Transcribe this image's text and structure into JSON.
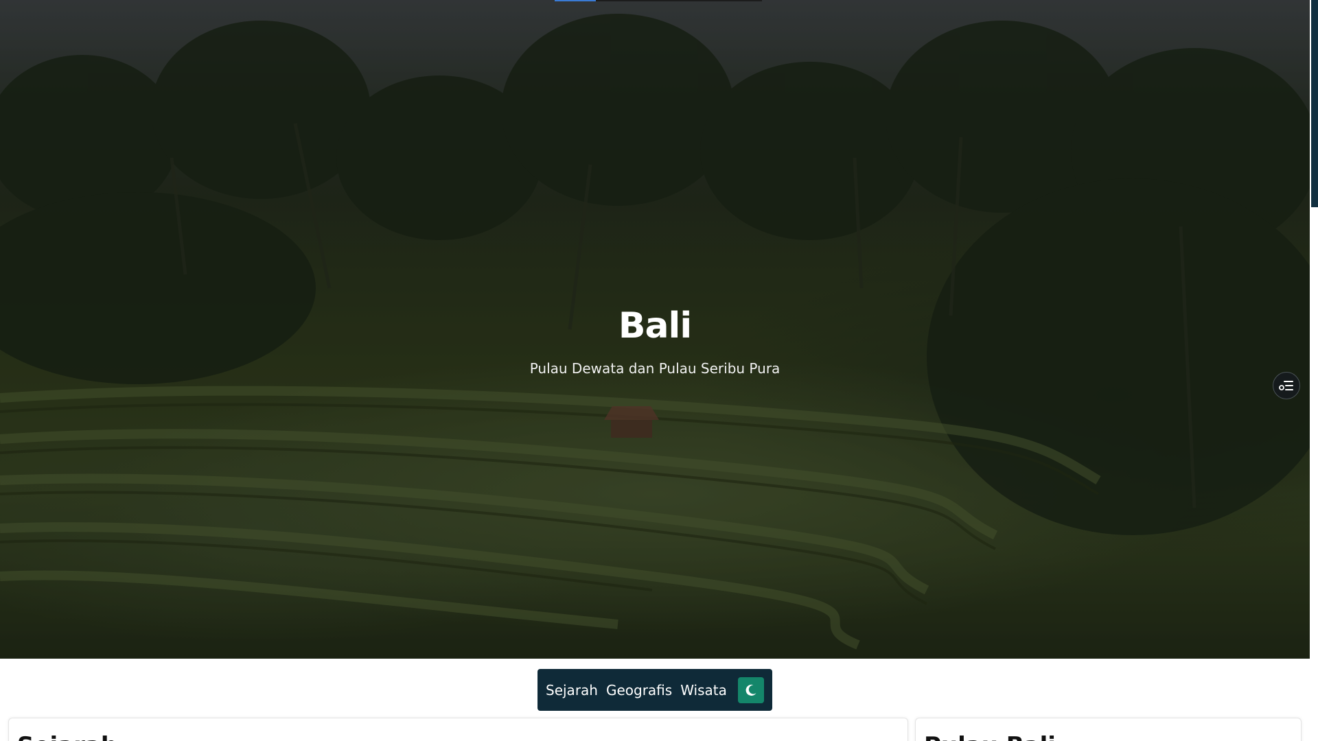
{
  "hero": {
    "title": "Bali",
    "subtitle": "Pulau Dewata dan Pulau Seribu Pura"
  },
  "reading_progress": 0.2,
  "nav": {
    "links": [
      "Sejarah",
      "Geografis",
      "Wisata"
    ],
    "theme_toggle_icon": "moon-icon"
  },
  "toc": {
    "icon": "list-settings-icon"
  },
  "sections": {
    "main_heading": "Sejarah",
    "side_heading": "Pulau Bali"
  },
  "colors": {
    "nav_background": "#0f2a38",
    "toggle_accent": "#14866a",
    "progress_accent": "#3a7bd5",
    "scrollbar_thumb": "#123040"
  }
}
